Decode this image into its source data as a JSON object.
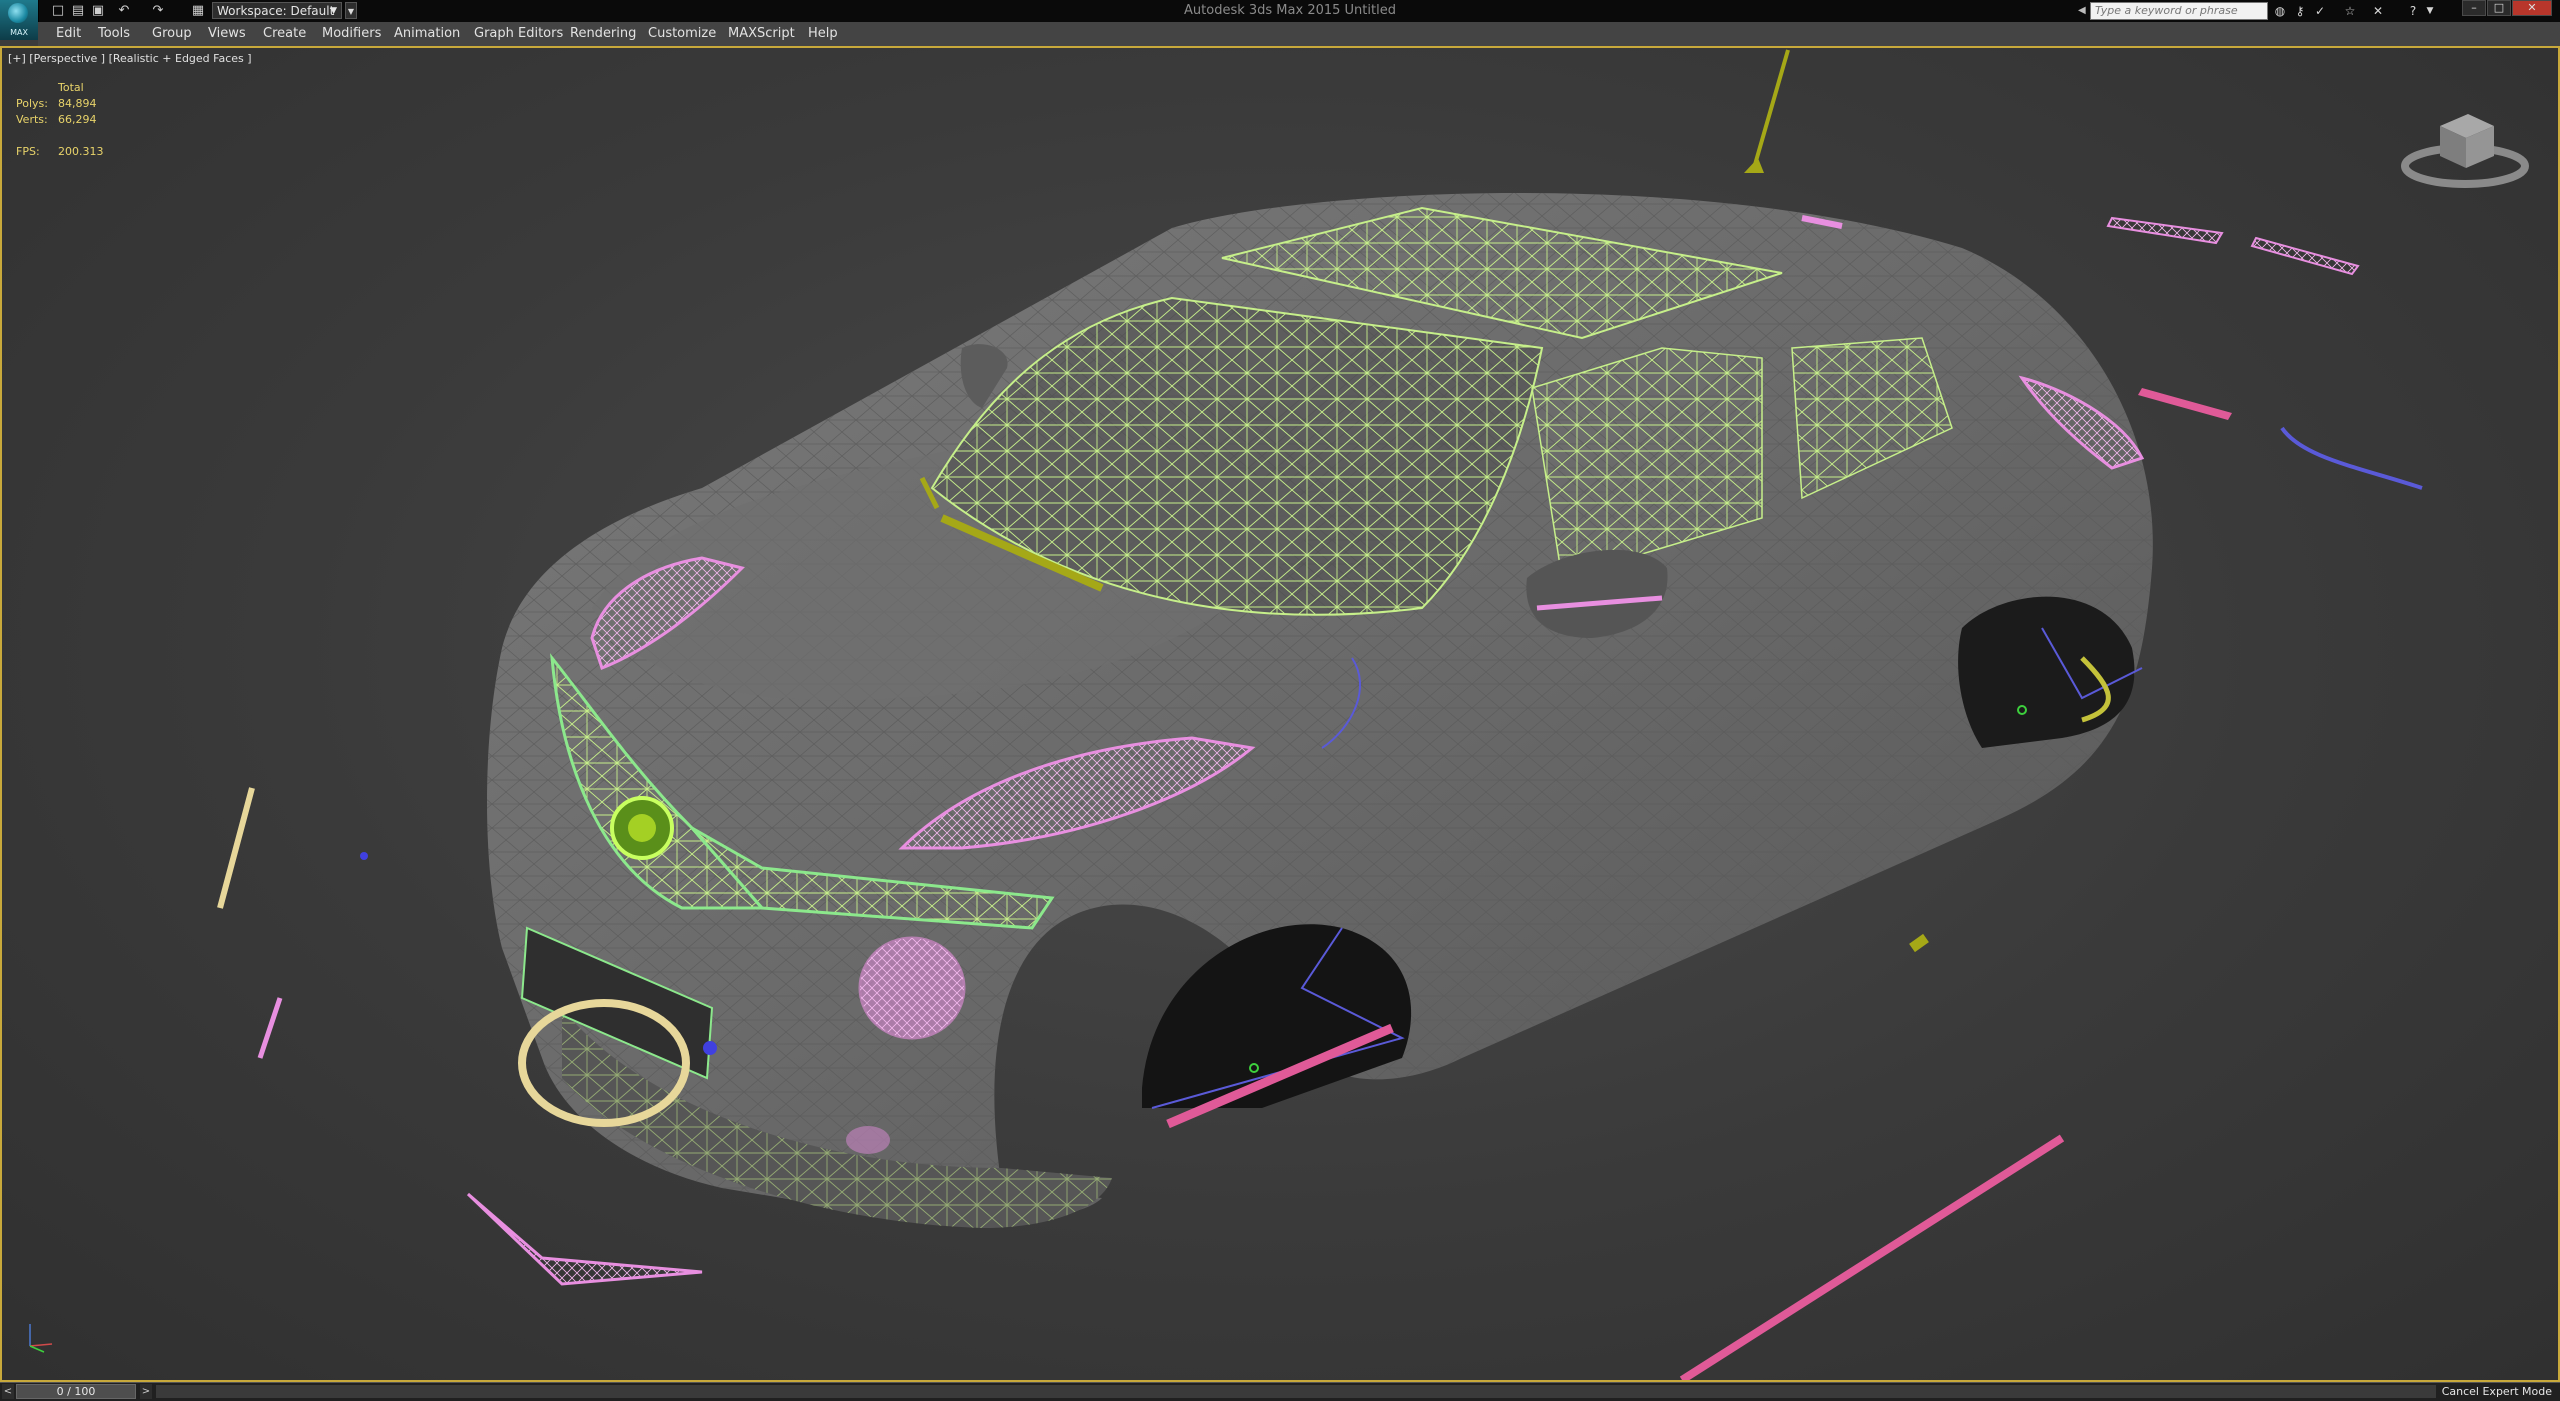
{
  "window": {
    "title": "Autodesk 3ds Max 2015    Untitled",
    "logo_text": "MAX",
    "workspace": "Workspace: Default",
    "search_placeholder": "Type a keyword or phrase"
  },
  "menu": [
    "Edit",
    "Tools",
    "Group",
    "Views",
    "Create",
    "Modifiers",
    "Animation",
    "Graph Editors",
    "Rendering",
    "Customize",
    "MAXScript",
    "Help"
  ],
  "viewport": {
    "label": "[+] [Perspective ] [Realistic + Edged Faces ]",
    "stats": {
      "header": "Total",
      "polys_label": "Polys:",
      "polys_value": "84,894",
      "verts_label": "Verts:",
      "verts_value": "66,294",
      "fps_label": "FPS:",
      "fps_value": "200.313"
    }
  },
  "status": {
    "time_slider": "0 / 100",
    "expert_button": "Cancel Expert Mode"
  },
  "icons": {
    "quick_access": [
      "new-file-icon",
      "open-file-icon",
      "save-icon",
      "undo-icon",
      "redo-icon",
      "project-icon"
    ],
    "infocenter": [
      "binoculars-icon",
      "key-icon",
      "communication-icon",
      "star-icon",
      "x-icon",
      "help-icon"
    ]
  },
  "colors": {
    "viewport_border": "#c8a93b",
    "stats_text": "#e8d36a",
    "wire_green": "#c6ef8a",
    "wire_pink": "#e88fe0",
    "wire_magenta": "#e05a98",
    "wire_blue": "#5a5ad8",
    "wire_yellow": "#e7d79a",
    "wire_olive": "#a5a817"
  }
}
